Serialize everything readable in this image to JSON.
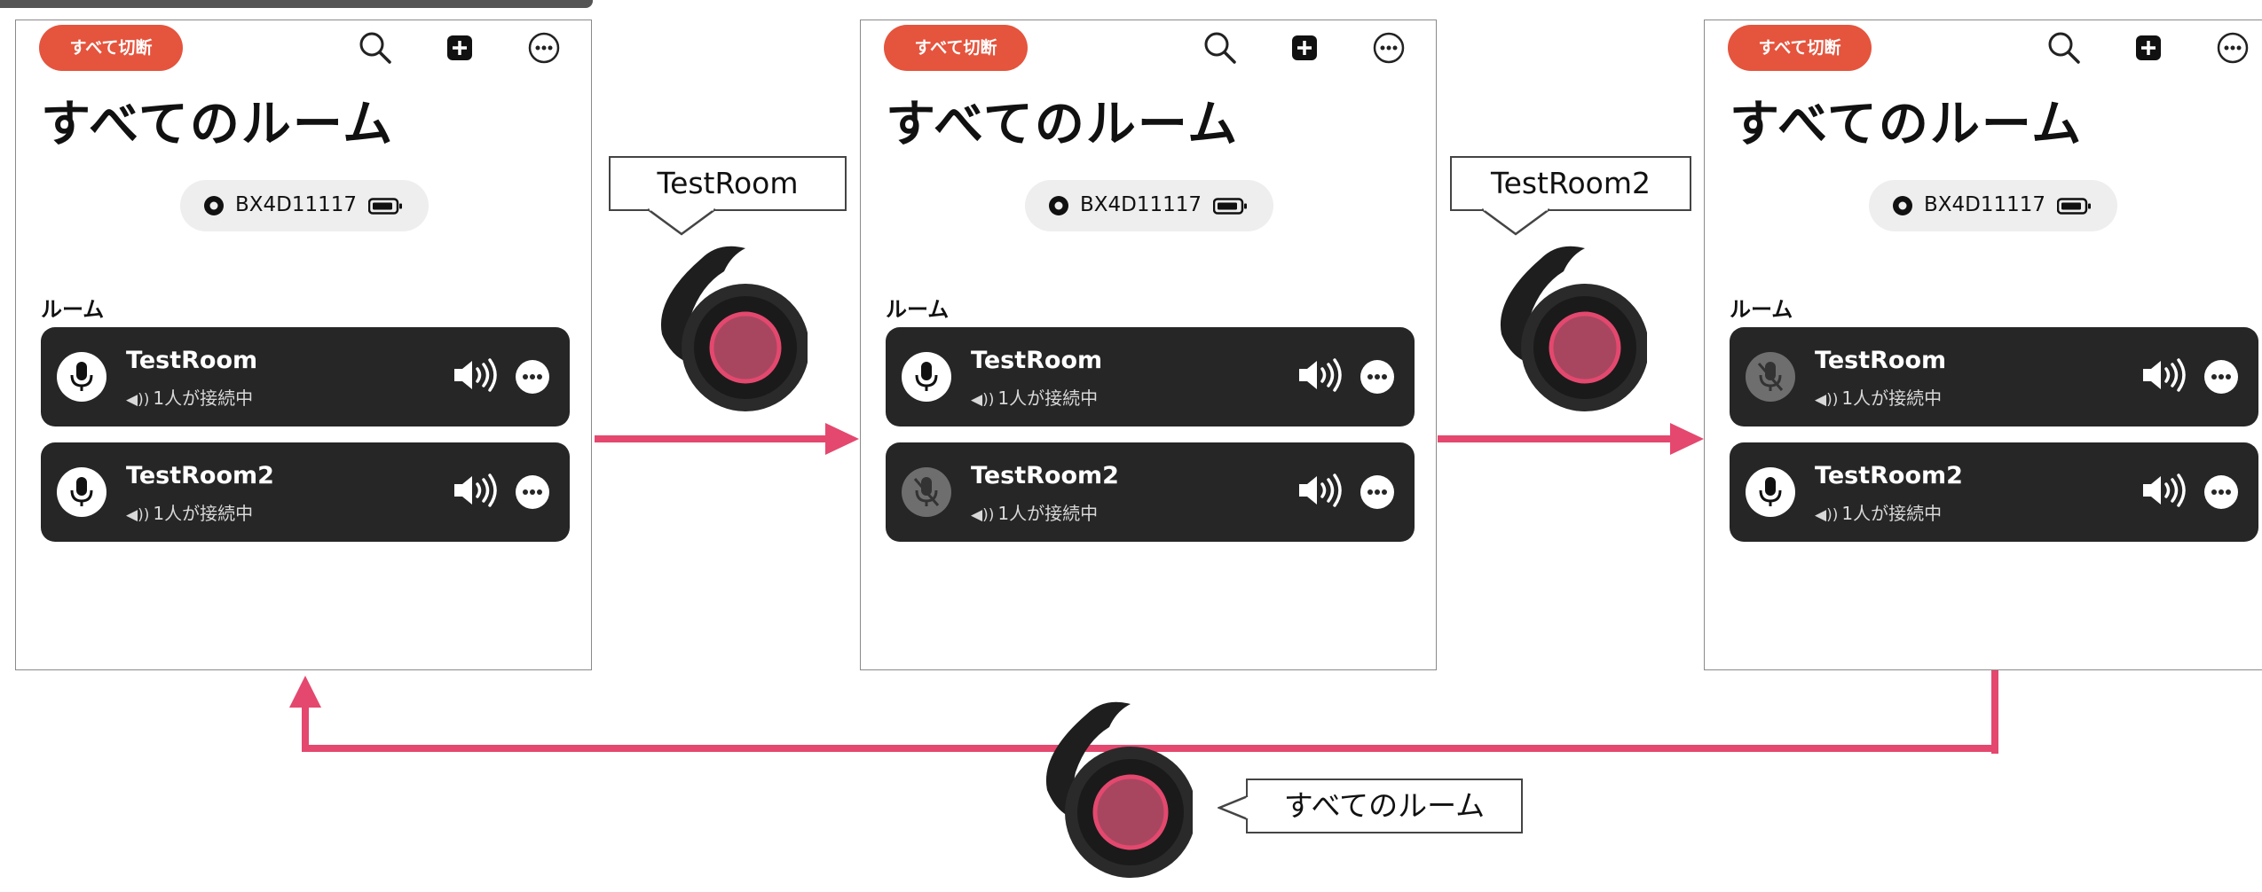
{
  "colors": {
    "accent_red": "#e5543d",
    "arrow_pink": "#e4486e",
    "card_dark": "#262626",
    "earbud_ring": "#e4486e"
  },
  "icons": {
    "search": "search-icon",
    "add": "plus-square-icon",
    "more": "ellipsis-circle-icon",
    "mic": "microphone-icon",
    "mic_muted": "microphone-slash-icon",
    "volume": "speaker-volume-icon",
    "battery": "battery-icon"
  },
  "panels": [
    {
      "disconnect_all": "すべて切断",
      "title": "すべてのルーム",
      "device_name": "BX4D11117",
      "section_label": "ルーム",
      "rooms": [
        {
          "name": "TestRoom",
          "status": "1人が接続中",
          "muted": false
        },
        {
          "name": "TestRoom2",
          "status": "1人が接続中",
          "muted": false
        }
      ]
    },
    {
      "disconnect_all": "すべて切断",
      "title": "すべてのルーム",
      "device_name": "BX4D11117",
      "section_label": "ルーム",
      "rooms": [
        {
          "name": "TestRoom",
          "status": "1人が接続中",
          "muted": false
        },
        {
          "name": "TestRoom2",
          "status": "1人が接続中",
          "muted": true
        }
      ]
    },
    {
      "disconnect_all": "すべて切断",
      "title": "すべてのルーム",
      "device_name": "BX4D11117",
      "section_label": "ルーム",
      "rooms": [
        {
          "name": "TestRoom",
          "status": "1人が接続中",
          "muted": true
        },
        {
          "name": "TestRoom2",
          "status": "1人が接続中",
          "muted": false
        }
      ]
    }
  ],
  "callouts": {
    "first": "TestRoom",
    "second": "TestRoom2",
    "third": "すべてのルーム"
  }
}
